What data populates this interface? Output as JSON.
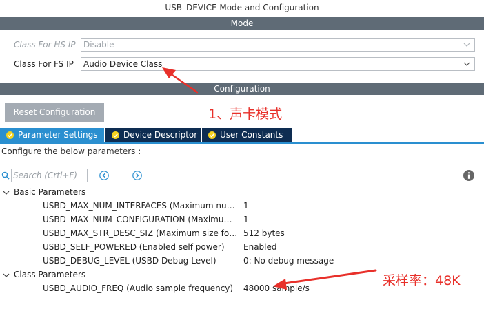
{
  "window": {
    "title": "USB_DEVICE Mode and Configuration"
  },
  "mode": {
    "header": "Mode",
    "hs": {
      "label": "Class For HS IP",
      "value": "Disable"
    },
    "fs": {
      "label": "Class For FS IP",
      "value": "Audio Device Class"
    }
  },
  "configuration": {
    "header": "Configuration",
    "reset_label": "Reset Configuration",
    "tabs": [
      {
        "label": "Parameter Settings"
      },
      {
        "label": "Device Descriptor"
      },
      {
        "label": "User Constants"
      }
    ],
    "configure_text": "Configure the below parameters :",
    "search_placeholder": "Search (Crtl+F)"
  },
  "tree": {
    "basic": {
      "label": "Basic Parameters",
      "items": [
        {
          "name": "USBD_MAX_NUM_INTERFACES (Maximum number of supported interfaces)",
          "value": "1"
        },
        {
          "name": "USBD_MAX_NUM_CONFIGURATION (Maximum number of supported configuration)",
          "value": "1"
        },
        {
          "name": "USBD_MAX_STR_DESC_SIZ (Maximum size for the string descriptors)",
          "value": "512 bytes"
        },
        {
          "name": "USBD_SELF_POWERED (Enabled self power)",
          "value": "Enabled"
        },
        {
          "name": "USBD_DEBUG_LEVEL (USBD Debug Level)",
          "value": "0: No debug message"
        }
      ]
    },
    "class": {
      "label": "Class Parameters",
      "items": [
        {
          "name": "USBD_AUDIO_FREQ (Audio sample frequency)",
          "value": "48000 sample/s"
        }
      ]
    }
  },
  "annotations": {
    "mode_note": "1、声卡模式",
    "freq_note": "采样率：48K"
  },
  "colors": {
    "section_bar": "#5f6b76",
    "tab_active": "#2a8fd0",
    "tab_inactive": "#0e2d52",
    "annotation": "#e8302a",
    "reset_button": "#a4abb3"
  },
  "icons": {
    "tab_check": "check-circle-icon",
    "search": "search-icon",
    "prev": "chevron-left-circle-icon",
    "next": "chevron-right-circle-icon",
    "info": "info-icon"
  }
}
